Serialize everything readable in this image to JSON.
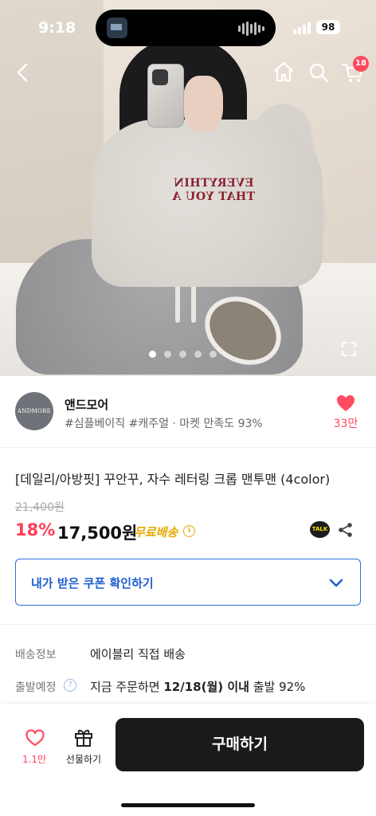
{
  "status_bar": {
    "time": "9:18",
    "battery": "98"
  },
  "top_nav": {
    "back_icon": "chevron-left-icon",
    "home_icon": "home-icon",
    "search_icon": "search-icon",
    "cart_icon": "cart-icon",
    "cart_badge": "18"
  },
  "hero": {
    "print_line1": "EVERYTHIN",
    "print_line2": "THAT YOU A",
    "image_count": 5,
    "active_index": 0
  },
  "seller": {
    "logo_text": "ANDMORE",
    "name": "앤드모어",
    "tags": "#심플베이직 #캐주얼 · 마켓 만족도 93%",
    "likes": "33만"
  },
  "product": {
    "title": "[데일리/아방핏] 꾸안꾸, 자수 레터링 크롭 맨투맨 (4color)",
    "original_price": "21,400원",
    "discount": "18%",
    "price": "17,500원",
    "free_shipping": "무료배송",
    "talk_label": "TALK"
  },
  "coupon": {
    "label": "내가 받은 쿠폰 확인하기"
  },
  "shipping_info": {
    "delivery_label": "배송정보",
    "delivery_value": "에이블리 직접 배송",
    "dispatch_label": "출발예정",
    "dispatch_prefix": "지금 주문하면",
    "dispatch_date": "12/18(월) 이내",
    "dispatch_suffix": "출발 92%"
  },
  "bottom_bar": {
    "wish_count": "1.1만",
    "gift_label": "선물하기",
    "buy_label": "구매하기"
  },
  "colors": {
    "accent_red": "#ff4a5f",
    "discount_red": "#ff3d57",
    "coupon_blue": "#1f5fd1",
    "free_ship_yellow": "#e6a800",
    "buy_button": "#1a1a1a"
  }
}
